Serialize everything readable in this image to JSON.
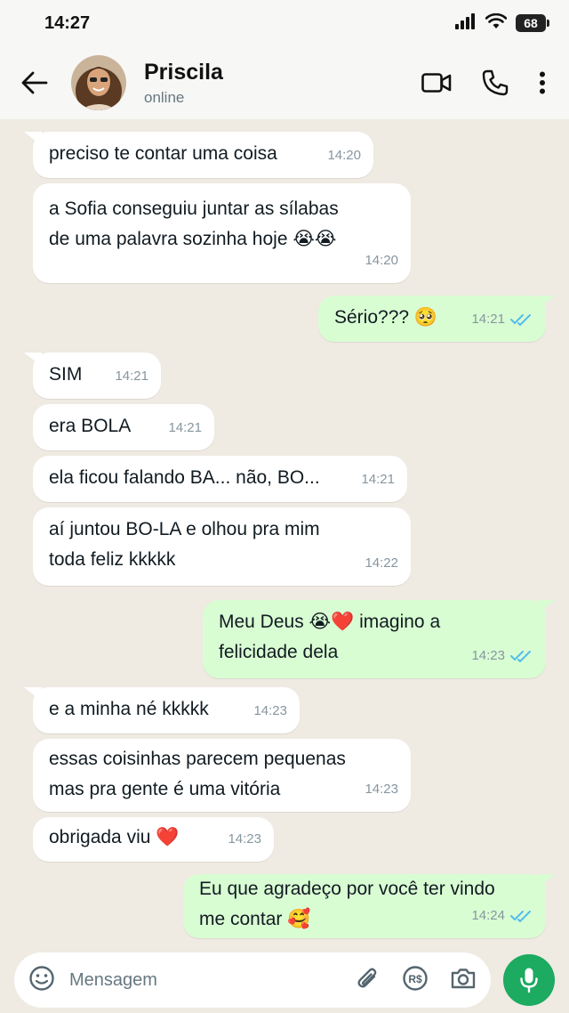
{
  "status_bar": {
    "time": "14:27",
    "battery": "68"
  },
  "header": {
    "name": "Priscila",
    "status": "online",
    "icons": [
      "back-arrow-icon",
      "video-call-icon",
      "voice-call-icon",
      "more-options-icon"
    ]
  },
  "messages": [
    {
      "dir": "in",
      "lines": [
        "preciso te contar uma coisa"
      ],
      "time": "14:20"
    },
    {
      "dir": "in",
      "lines": [
        "a Sofia conseguiu juntar as sílabas",
        "de uma palavra sozinha hoje 😭😭"
      ],
      "time": "14:20"
    },
    {
      "dir": "out",
      "lines": [
        "Sério??? 🥺"
      ],
      "time": "14:21",
      "read": true
    },
    {
      "dir": "in",
      "lines": [
        "SIM"
      ],
      "time": "14:21"
    },
    {
      "dir": "in",
      "lines": [
        "era BOLA"
      ],
      "time": "14:21"
    },
    {
      "dir": "in",
      "lines": [
        "ela ficou falando BA... não, BO..."
      ],
      "time": "14:21"
    },
    {
      "dir": "in",
      "lines": [
        "aí juntou BO-LA e olhou pra mim",
        "toda feliz kkkkk"
      ],
      "time": "14:22"
    },
    {
      "dir": "out",
      "lines": [
        "Meu Deus 😭❤️ imagino a",
        "felicidade dela"
      ],
      "time": "14:23",
      "read": true
    },
    {
      "dir": "in",
      "lines": [
        "e a minha né kkkkk"
      ],
      "time": "14:23"
    },
    {
      "dir": "in",
      "lines": [
        "essas coisinhas parecem pequenas",
        "mas pra gente é uma vitória"
      ],
      "time": "14:23"
    },
    {
      "dir": "in",
      "lines": [
        "obrigada viu ❤️"
      ],
      "time": "14:23"
    },
    {
      "dir": "out",
      "lines": [
        "Eu que agradeço por você ter vindo",
        "me contar 🥰"
      ],
      "time": "14:24",
      "read": true
    }
  ],
  "input": {
    "placeholder": "Mensagem",
    "icons": [
      "emoji-icon",
      "attach-icon",
      "payment-icon",
      "camera-icon",
      "mic-icon"
    ]
  },
  "colors": {
    "background": "#efeae2",
    "incoming": "#ffffff",
    "outgoing": "#d9fdd3",
    "accent": "#1daa61",
    "read_ticks": "#53bdeb"
  }
}
